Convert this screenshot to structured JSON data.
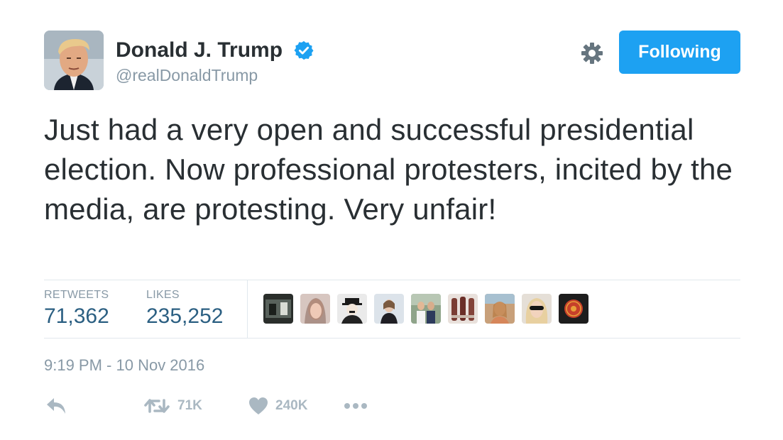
{
  "user": {
    "display_name": "Donald J. Trump",
    "handle": "@realDonaldTrump",
    "verified": true
  },
  "follow_button": {
    "label": "Following",
    "color": "#1da1f2"
  },
  "tweet": {
    "text": "Just had a very open and successful presidential election. Now professional protesters, incited by the media, are protesting. Very unfair!",
    "timestamp": "9:19 PM - 10 Nov 2016"
  },
  "stats": {
    "retweets_label": "RETWEETS",
    "retweets_value": "71,362",
    "likes_label": "LIKES",
    "likes_value": "235,252"
  },
  "likers": [
    {
      "name": "liker-1"
    },
    {
      "name": "liker-2"
    },
    {
      "name": "liker-3"
    },
    {
      "name": "liker-4"
    },
    {
      "name": "liker-5"
    },
    {
      "name": "liker-6"
    },
    {
      "name": "liker-7"
    },
    {
      "name": "liker-8"
    },
    {
      "name": "liker-9"
    }
  ],
  "actions": {
    "retweet_count": "71K",
    "like_count": "240K"
  },
  "colors": {
    "accent": "#1da1f2",
    "muted": "#8899a6",
    "stat_value": "#2b5f82",
    "icon": "#aab8c2"
  }
}
